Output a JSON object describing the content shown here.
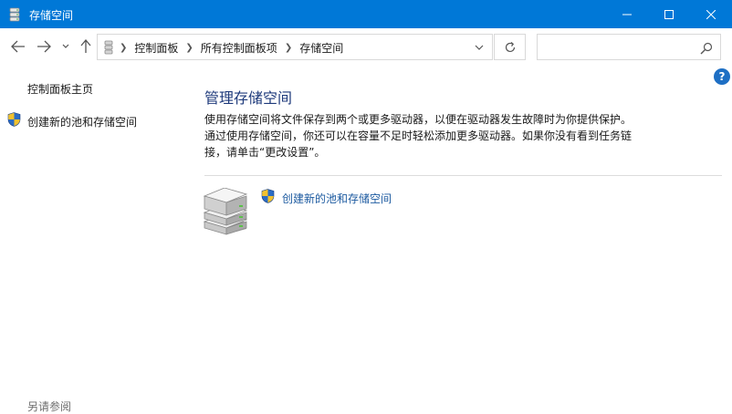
{
  "window": {
    "title": "存储空间",
    "icon": "storage-drives-icon"
  },
  "nav": {
    "breadcrumbs": [
      "控制面板",
      "所有控制面板项",
      "存储空间"
    ],
    "search_value": ""
  },
  "sidebar": {
    "home_link": "控制面板主页",
    "create_link": "创建新的池和存储空间",
    "see_also": "另请参阅"
  },
  "main": {
    "heading": "管理存储空间",
    "description_lines": [
      "使用存储空间将文件保存到两个或更多驱动器，以便在驱动器发生故障时为你提供保护。",
      "通过使用存储空间，你还可以在容量不足时轻松添加更多驱动器。如果你没有看到任务链",
      "接，请单击“更改设置”。"
    ],
    "create_link": "创建新的池和存储空间"
  },
  "colors": {
    "titlebar": "#0078d7",
    "heading": "#1e3a7b",
    "link": "#1c5aa0"
  }
}
